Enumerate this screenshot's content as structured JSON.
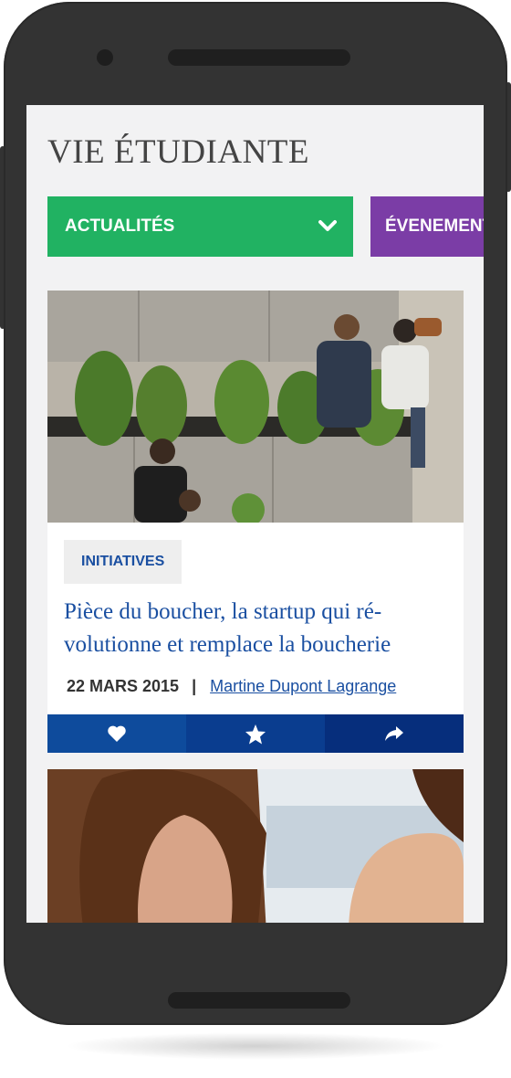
{
  "header": {
    "title": "VIE ÉTUDIANTE"
  },
  "tabs": [
    {
      "label": "ACTUALITÉS",
      "color": "#21b262"
    },
    {
      "label": "ÉVENEMENTS",
      "color": "#7b3da6"
    }
  ],
  "article": {
    "category": "INITIATIVES",
    "headline": "Pièce du boucher, la startup qui ré-volutionne et remplace la boucherie",
    "date": "22 MARS 2015",
    "separator": "|",
    "author": "Martine Dupont Lagrange",
    "actions": [
      "heart-icon",
      "star-icon",
      "share-icon"
    ]
  },
  "colors": {
    "accent_blue": "#1a4fa1",
    "action_bar": [
      "#0e4b9c",
      "#0a3d8f",
      "#062e7c"
    ]
  }
}
